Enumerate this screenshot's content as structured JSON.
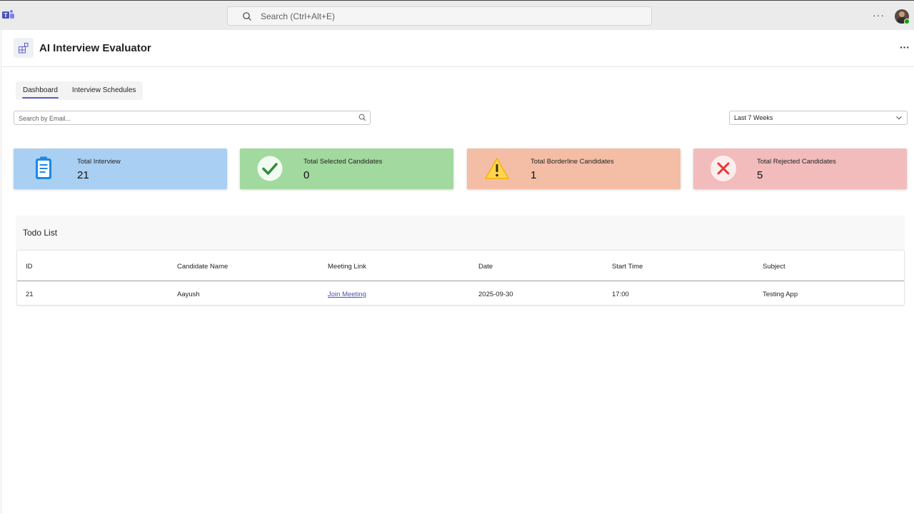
{
  "topbar": {
    "search_placeholder": "Search (Ctrl+Alt+E)",
    "more_label": "···"
  },
  "app": {
    "title": "AI Interview Evaluator",
    "more_label": "···"
  },
  "tabs": [
    {
      "label": "Dashboard",
      "active": true
    },
    {
      "label": "Interview Schedules",
      "active": false
    }
  ],
  "filters": {
    "email_placeholder": "Search by Email...",
    "range_value": "Last 7 Weeks"
  },
  "cards": [
    {
      "label": "Total Interview",
      "value": "21",
      "color": "#a9d0f2",
      "icon": "clipboard-icon"
    },
    {
      "label": "Total Selected Candidates",
      "value": "0",
      "color": "#a1d99e",
      "icon": "checkmark-icon"
    },
    {
      "label": "Total Borderline Candidates",
      "value": "1",
      "color": "#f4bea6",
      "icon": "warning-icon"
    },
    {
      "label": "Total Rejected Candidates",
      "value": "5",
      "color": "#f2bcbc",
      "icon": "close-icon"
    }
  ],
  "todo": {
    "title": "Todo List",
    "columns": [
      "ID",
      "Candidate Name",
      "Meeting Link",
      "Date",
      "Start Time",
      "Subject"
    ],
    "rows": [
      {
        "id": "21",
        "candidate": "Aayush",
        "link": "Join Meeting",
        "date": "2025-09-30",
        "start": "17:00",
        "subject": "Testing App"
      }
    ]
  },
  "colors": {
    "accent": "#5b5fc7",
    "link": "#4f52b2",
    "success_badge": "#13a10e"
  }
}
